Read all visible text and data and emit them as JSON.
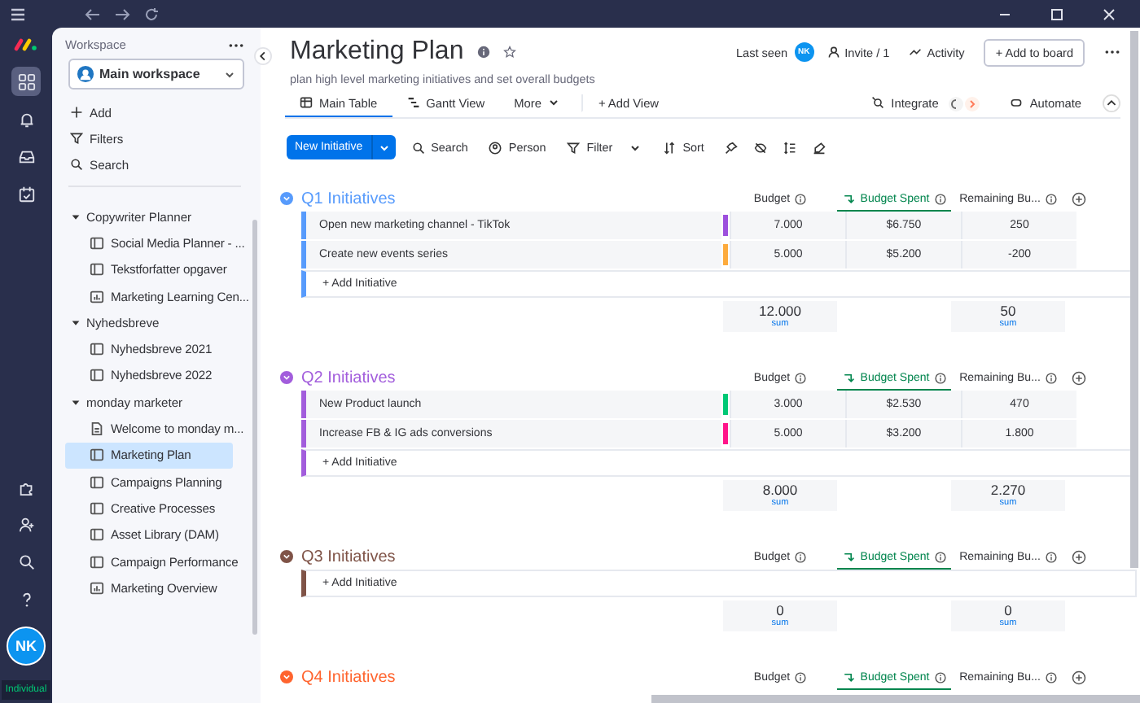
{
  "rail": {
    "items": [
      {
        "kind": "grid",
        "selected": true
      },
      {
        "kind": "bell",
        "selected": false
      },
      {
        "kind": "inbox",
        "selected": false
      },
      {
        "kind": "calendar",
        "selected": false
      }
    ],
    "avatar": "NK",
    "plan": "Individual"
  },
  "sidebar": {
    "label": "Workspace",
    "workspace": "Main workspace",
    "actions": [
      {
        "kind": "add",
        "label": "Add"
      },
      {
        "kind": "filter",
        "label": "Filters"
      },
      {
        "kind": "search",
        "label": "Search"
      }
    ],
    "folders": [
      {
        "name": "Copywriter Planner",
        "expanded": true,
        "children": [
          {
            "name": "Social Media Planner - ...",
            "kind": "board",
            "selected": false
          },
          {
            "name": "Tekstforfatter opgaver",
            "kind": "board",
            "selected": false
          },
          {
            "name": "Marketing Learning Cen...",
            "kind": "dashboard",
            "selected": false
          }
        ]
      },
      {
        "name": "Nyhedsbreve",
        "expanded": true,
        "children": [
          {
            "name": "Nyhedsbreve 2021",
            "kind": "board",
            "selected": false
          },
          {
            "name": "Nyhedsbreve 2022",
            "kind": "board",
            "selected": false
          }
        ]
      },
      {
        "name": "monday marketer",
        "expanded": true,
        "children": [
          {
            "name": "Welcome to monday m...",
            "kind": "doc",
            "selected": false
          },
          {
            "name": "Marketing Plan",
            "kind": "board",
            "selected": true
          },
          {
            "name": "Campaigns Planning",
            "kind": "board",
            "selected": false
          },
          {
            "name": "Creative Processes",
            "kind": "board",
            "selected": false
          },
          {
            "name": "Asset Library (DAM)",
            "kind": "board",
            "selected": false
          },
          {
            "name": "Campaign Performance",
            "kind": "board",
            "selected": false
          },
          {
            "name": "Marketing Overview",
            "kind": "dashboard",
            "selected": false
          }
        ]
      }
    ]
  },
  "board": {
    "title": "Marketing Plan",
    "description": "plan high level marketing initiatives and set overall budgets",
    "last_seen": "Last seen",
    "last_seen_avatar": "NK",
    "invite": "Invite / 1",
    "activity": "Activity",
    "add_to_board": "+ Add to board",
    "tabs": [
      {
        "kind": "table",
        "label": "Main Table",
        "selected": true
      },
      {
        "kind": "gantt",
        "label": "Gantt View",
        "selected": false
      },
      {
        "kind": "more",
        "label": "More",
        "selected": false
      },
      {
        "kind": "add",
        "label": "+ Add View",
        "selected": false
      }
    ],
    "integrate": "Integrate",
    "automate": "Automate",
    "new_button": "New Initiative",
    "tools": [
      {
        "kind": "search",
        "label": "Search"
      },
      {
        "kind": "person",
        "label": "Person"
      },
      {
        "kind": "filter",
        "label": "Filter"
      },
      {
        "kind": "sort",
        "label": "Sort"
      }
    ]
  },
  "groups": [
    {
      "name": "Q1 Initiatives",
      "color": "#579bfc",
      "columns": [
        "Budget",
        "Budget Spent",
        "Remaining Bu..."
      ],
      "rows": [
        {
          "name": "Open new marketing channel - TikTok",
          "color": "#9d50dd",
          "budget": "7.000",
          "spent": "$6.750",
          "remaining": "250"
        },
        {
          "name": "Create new events series",
          "color": "#fdab3d",
          "budget": "5.000",
          "spent": "$5.200",
          "remaining": "-200"
        }
      ],
      "add_label": "+ Add Initiative",
      "budget_sum": {
        "value": "12.000",
        "label": "sum"
      },
      "remaining_sum": {
        "value": "50",
        "label": "sum"
      }
    },
    {
      "name": "Q2 Initiatives",
      "color": "#a25ddc",
      "columns": [
        "Budget",
        "Budget Spent",
        "Remaining Bu..."
      ],
      "rows": [
        {
          "name": "New Product launch",
          "color": "#00c875",
          "budget": "3.000",
          "spent": "$2.530",
          "remaining": "470"
        },
        {
          "name": "Increase FB & IG ads conversions",
          "color": "#ff158a",
          "budget": "5.000",
          "spent": "$3.200",
          "remaining": "1.800"
        }
      ],
      "add_label": "+ Add Initiative",
      "budget_sum": {
        "value": "8.000",
        "label": "sum"
      },
      "remaining_sum": {
        "value": "2.270",
        "label": "sum"
      }
    },
    {
      "name": "Q3 Initiatives",
      "color": "#7f5347",
      "columns": [
        "Budget",
        "Budget Spent",
        "Remaining Bu..."
      ],
      "add_label": "+ Add Initiative",
      "budget_sum": {
        "value": "0",
        "label": "sum"
      },
      "remaining_sum": {
        "value": "0",
        "label": "sum"
      }
    },
    {
      "name": "Q4 Initiatives",
      "color": "#ff642e",
      "columns": [
        "Budget",
        "Budget Spent",
        "Remaining Bu..."
      ]
    }
  ]
}
